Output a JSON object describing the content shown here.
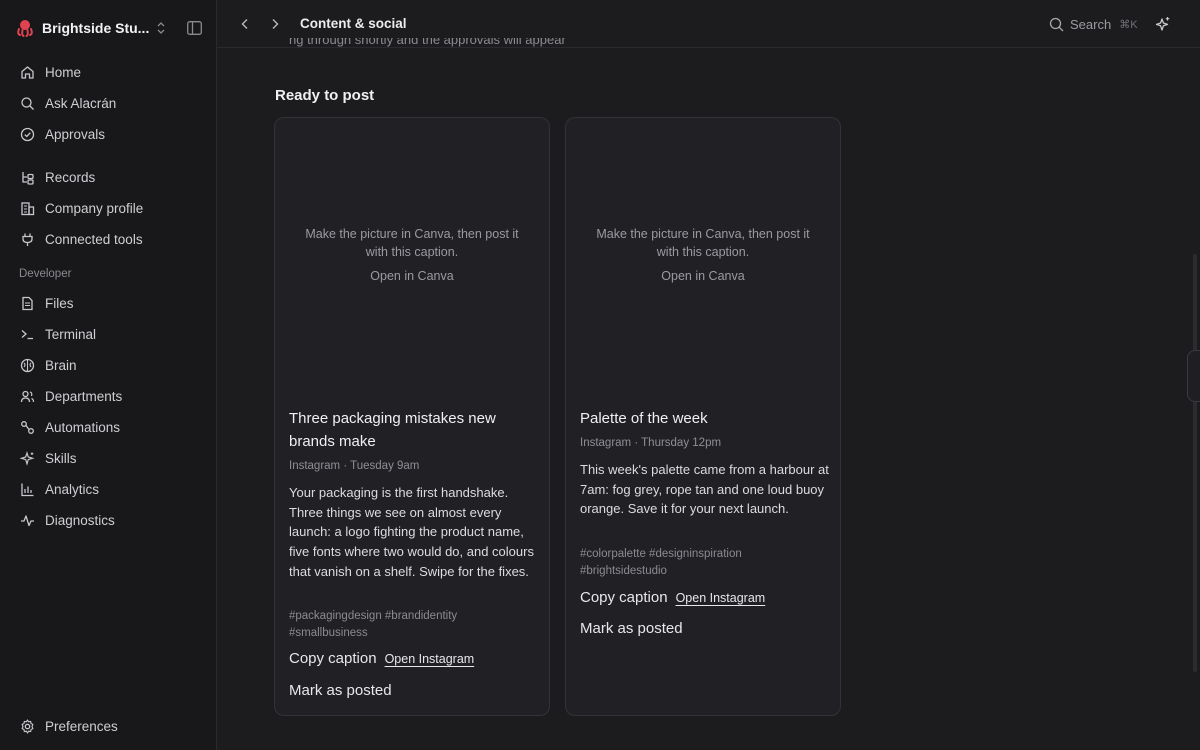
{
  "colors": {
    "accent": "#e0434f",
    "background": "#1c1c1f",
    "sidebar": "#18181b"
  },
  "workspace": {
    "name": "Brightside Stu...",
    "logo_icon": "octopus-icon"
  },
  "sidebar": {
    "main": [
      {
        "label": "Home",
        "icon": "home-icon"
      },
      {
        "label": "Ask Alacrán",
        "icon": "search-icon"
      },
      {
        "label": "Approvals",
        "icon": "check-circle-icon"
      }
    ],
    "records": [
      {
        "label": "Records",
        "icon": "records-icon"
      },
      {
        "label": "Company profile",
        "icon": "building-icon"
      },
      {
        "label": "Connected tools",
        "icon": "plug-icon"
      }
    ],
    "developer_heading": "Developer",
    "developer": [
      {
        "label": "Files",
        "icon": "file-icon"
      },
      {
        "label": "Terminal",
        "icon": "terminal-icon"
      },
      {
        "label": "Brain",
        "icon": "brain-icon"
      },
      {
        "label": "Departments",
        "icon": "people-icon"
      },
      {
        "label": "Automations",
        "icon": "automation-icon"
      },
      {
        "label": "Skills",
        "icon": "sparkles-icon"
      },
      {
        "label": "Analytics",
        "icon": "bar-chart-icon"
      },
      {
        "label": "Diagnostics",
        "icon": "pulse-icon"
      }
    ],
    "footer": {
      "label": "Preferences",
      "icon": "gear-icon"
    }
  },
  "topbar": {
    "title": "Content & social",
    "search_label": "Search",
    "search_shortcut": "⌘K"
  },
  "main": {
    "cut_line": "ng through shortly and the approvals will appear",
    "section_title": "Ready to post",
    "cards": [
      {
        "placeholder_text": "Make the picture in Canva, then post it with this caption.",
        "placeholder_link": "Open in Canva",
        "title": "Three packaging mistakes new brands make",
        "meta": "Instagram · Tuesday 9am",
        "body": "Your packaging is the first handshake. Three things we see on almost every launch: a logo fighting the product name, five fonts where two would do, and colours that vanish on a shelf. Swipe for the fixes.",
        "tags": "#packagingdesign #brandidentity #smallbusiness",
        "copy_label": "Copy caption",
        "open_label": "Open Instagram",
        "mark_label": "Mark as posted"
      },
      {
        "placeholder_text": "Make the picture in Canva, then post it with this caption.",
        "placeholder_link": "Open in Canva",
        "title": "Palette of the week",
        "meta": "Instagram · Thursday 12pm",
        "body": "This week's palette came from a harbour at 7am: fog grey, rope tan and one loud buoy orange. Save it for your next launch.",
        "tags": "#colorpalette #designinspiration #brightsidestudio",
        "copy_label": "Copy caption",
        "open_label": "Open Instagram",
        "mark_label": "Mark as posted"
      }
    ]
  }
}
